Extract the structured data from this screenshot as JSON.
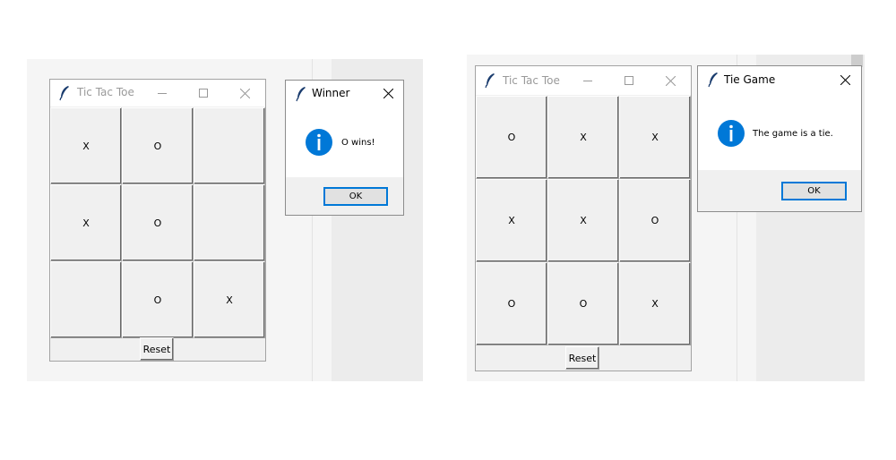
{
  "colors": {
    "accent": "#0078d7",
    "info_icon": "#0078d7",
    "window_bg": "#f0f0f0",
    "backdrop": "#f5f5f5"
  },
  "left": {
    "window": {
      "title": "Tic Tac Toe",
      "icon": "feather-icon",
      "controls": [
        "minimize-icon",
        "maximize-icon",
        "close-icon"
      ]
    },
    "board": [
      [
        "X",
        "O",
        ""
      ],
      [
        "X",
        "O",
        ""
      ],
      [
        "",
        "O",
        "X"
      ]
    ],
    "reset_label": "Reset",
    "dialog": {
      "title": "Winner",
      "message": "O wins!",
      "ok_label": "OK",
      "icon": "info-icon"
    }
  },
  "right": {
    "window": {
      "title": "Tic Tac Toe",
      "icon": "feather-icon",
      "controls": [
        "minimize-icon",
        "maximize-icon",
        "close-icon"
      ]
    },
    "board": [
      [
        "O",
        "X",
        "X"
      ],
      [
        "X",
        "X",
        "O"
      ],
      [
        "O",
        "O",
        "X"
      ]
    ],
    "reset_label": "Reset",
    "dialog": {
      "title": "Tie Game",
      "message": "The game is a tie.",
      "ok_label": "OK",
      "icon": "info-icon"
    }
  }
}
